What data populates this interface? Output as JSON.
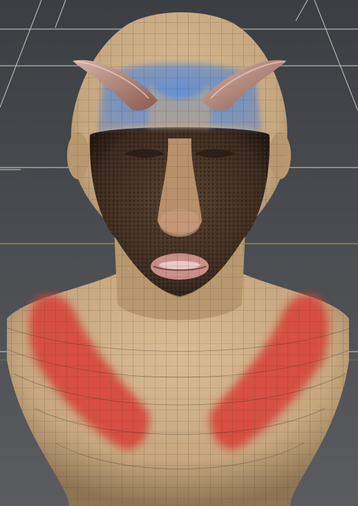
{
  "viewport": {
    "background_colors": {
      "top": "#3b3e42",
      "bottom": "#5a5c60"
    },
    "grid_color": "#c9c9c9",
    "axis_color": "#c8b24a"
  },
  "model": {
    "skin_color": "#c6a77f",
    "skin_shadow_color": "#8f7454",
    "wireframe_color": "#3a2e22",
    "texture_region_color": "#3b2a1f",
    "mask_colors": {
      "brow": "#4a7fd1",
      "shoulders": "#d8453a"
    },
    "horn_color": "#b7867a",
    "lips_color": "#c98f88"
  }
}
